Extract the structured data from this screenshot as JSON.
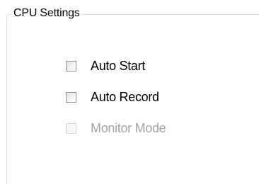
{
  "group": {
    "title": "CPU Settings"
  },
  "checkboxes": [
    {
      "label": "Auto Start",
      "checked": false,
      "enabled": true
    },
    {
      "label": "Auto Record",
      "checked": false,
      "enabled": true
    },
    {
      "label": "Monitor Mode",
      "checked": false,
      "enabled": false
    }
  ]
}
